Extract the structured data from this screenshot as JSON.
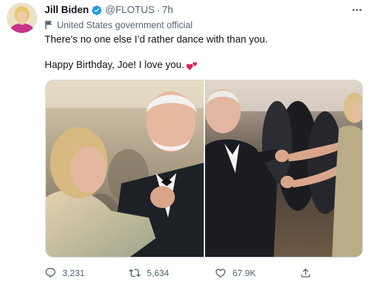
{
  "author": {
    "display_name": "Jill Biden",
    "handle": "@FLOTUS",
    "separator": "·",
    "time": "7h",
    "account_label": "United States government official"
  },
  "icons": {
    "verified": "verified-badge-icon",
    "more": "more-options-icon",
    "label": "government-flag-icon",
    "emoji": "two-hearts-icon",
    "reply": "reply-icon",
    "retweet": "retweet-icon",
    "like": "like-icon",
    "share": "share-icon"
  },
  "colors": {
    "verified": "#1d9bf0",
    "secondary_text": "#536471",
    "hearts": "#e0245e"
  },
  "tweet": {
    "line1": "There’s no one else I’d rather dance with than you.",
    "line2": "Happy Birthday, Joe! I love you."
  },
  "media": {
    "photo_count": 2
  },
  "actions": {
    "replies": "3,231",
    "retweets": "5,634",
    "likes": "67.9K"
  }
}
